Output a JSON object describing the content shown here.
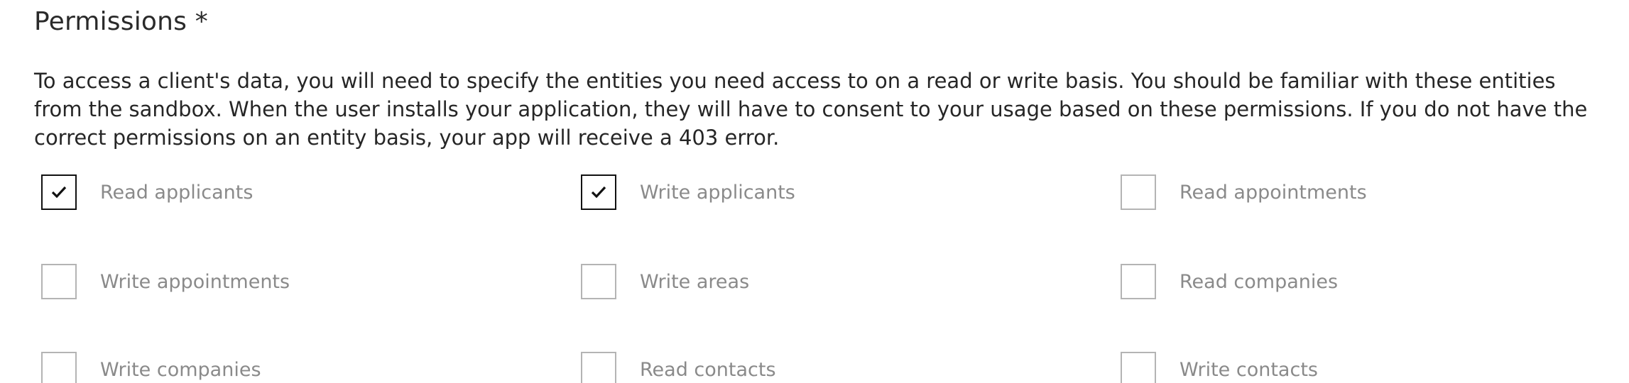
{
  "section": {
    "title": "Permissions *",
    "description": "To access a client's data, you will need to specify the entities you need access to on a read or write basis. You should be familiar with these entities from the sandbox. When the user installs your application, they will have to consent to your usage based on these permissions. If you do not have the correct permissions on an entity basis, your app will receive a 403 error."
  },
  "permissions": [
    {
      "label": "Read applicants",
      "checked": true
    },
    {
      "label": "Write applicants",
      "checked": true
    },
    {
      "label": "Read appointments",
      "checked": false
    },
    {
      "label": "Write appointments",
      "checked": false
    },
    {
      "label": "Write areas",
      "checked": false
    },
    {
      "label": "Read companies",
      "checked": false
    },
    {
      "label": "Write companies",
      "checked": false
    },
    {
      "label": "Read contacts",
      "checked": false
    },
    {
      "label": "Write contacts",
      "checked": false
    }
  ],
  "icons": {
    "checked": "check-icon"
  }
}
